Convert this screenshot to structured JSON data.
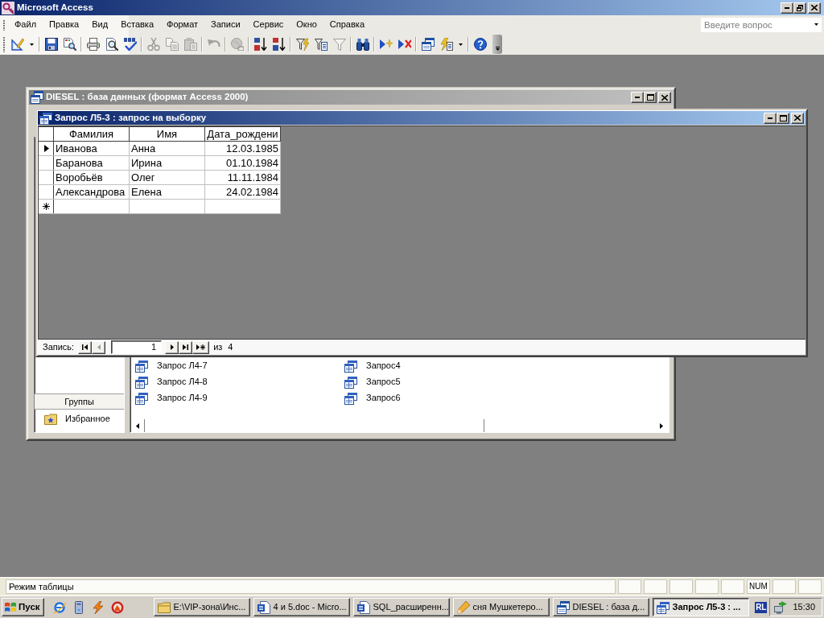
{
  "app": {
    "title": "Microsoft Access",
    "controls": [
      {
        "kind": "minimize"
      },
      {
        "kind": "restore"
      },
      {
        "kind": "close"
      }
    ]
  },
  "menu": [
    "Файл",
    "Правка",
    "Вид",
    "Вставка",
    "Формат",
    "Записи",
    "Сервис",
    "Окно",
    "Справка"
  ],
  "help_box": {
    "placeholder": "Введите вопрос"
  },
  "toolbar": [
    [
      {
        "kind": "view",
        "disabled": false,
        "dropdown": true
      }
    ],
    [
      {
        "kind": "save",
        "disabled": false,
        "dropdown": false
      },
      {
        "kind": "file_search",
        "disabled": false,
        "dropdown": false
      }
    ],
    [
      {
        "kind": "print",
        "disabled": false,
        "dropdown": false
      },
      {
        "kind": "preview",
        "disabled": false,
        "dropdown": false
      },
      {
        "kind": "spelling",
        "disabled": false,
        "dropdown": false
      }
    ],
    [
      {
        "kind": "cut",
        "disabled": true,
        "dropdown": false
      },
      {
        "kind": "copy",
        "disabled": true,
        "dropdown": false
      },
      {
        "kind": "paste",
        "disabled": true,
        "dropdown": false
      }
    ],
    [
      {
        "kind": "undo",
        "disabled": true,
        "dropdown": false
      }
    ],
    [
      {
        "kind": "hyperlink",
        "disabled": true,
        "dropdown": false
      }
    ],
    [
      {
        "kind": "sort_asc",
        "disabled": false,
        "dropdown": false
      },
      {
        "kind": "sort_desc",
        "disabled": false,
        "dropdown": false
      }
    ],
    [
      {
        "kind": "filter_selection",
        "disabled": false,
        "dropdown": false
      },
      {
        "kind": "filter_form",
        "disabled": false,
        "dropdown": false
      },
      {
        "kind": "apply_filter",
        "disabled": true,
        "dropdown": false
      }
    ],
    [
      {
        "kind": "find",
        "disabled": false,
        "dropdown": false
      }
    ],
    [
      {
        "kind": "new_record",
        "disabled": false,
        "dropdown": false
      },
      {
        "kind": "delete_record",
        "disabled": false,
        "dropdown": false
      }
    ],
    [
      {
        "kind": "db_window",
        "disabled": false,
        "dropdown": false
      },
      {
        "kind": "new_object",
        "disabled": false,
        "dropdown": true
      }
    ],
    [
      {
        "kind": "help",
        "disabled": false,
        "dropdown": false
      }
    ]
  ],
  "db_window": {
    "title": "DIESEL : база данных (формат Access 2000)",
    "active": false,
    "controls": [
      {
        "kind": "minimize"
      },
      {
        "kind": "maximize"
      },
      {
        "kind": "close"
      }
    ],
    "groups": {
      "header": "Группы",
      "items": [
        "Избранное"
      ]
    },
    "objects": [
      "Запрос Л4-7",
      "Запрос Л4-8",
      "Запрос Л4-9",
      "Запрос4",
      "Запрос5",
      "Запрос6"
    ]
  },
  "query_window": {
    "title": "Запрос Л5-3 : запрос на выборку",
    "active": true,
    "controls": [
      {
        "kind": "minimize"
      },
      {
        "kind": "maximize"
      },
      {
        "kind": "close"
      }
    ],
    "columns": [
      {
        "label": "Фамилия",
        "kind": "text"
      },
      {
        "label": "Имя",
        "kind": "text"
      },
      {
        "label": "Дата_рождени",
        "kind": "date"
      }
    ],
    "rows": [
      {
        "cells": [
          "Иванова",
          "Анна",
          "12.03.1985"
        ],
        "current": true
      },
      {
        "cells": [
          "Баранова",
          "Ирина",
          "01.10.1984"
        ],
        "current": false
      },
      {
        "cells": [
          "Воробьёв",
          "Олег",
          "11.11.1984"
        ],
        "current": false
      },
      {
        "cells": [
          "Александрова",
          "Елена",
          "24.02.1984"
        ],
        "current": false
      }
    ],
    "new_row": true,
    "navigator": {
      "label": "Запись:",
      "buttons_before": [
        {
          "kind": "first",
          "disabled": false
        },
        {
          "kind": "prev",
          "disabled": true
        }
      ],
      "record": "1",
      "buttons_after": [
        {
          "kind": "next",
          "disabled": false
        },
        {
          "kind": "last",
          "disabled": false
        },
        {
          "kind": "new",
          "disabled": false
        }
      ],
      "of": "из",
      "total": "4"
    }
  },
  "status_bar": {
    "text": "Режим таблицы",
    "indicators": [
      "NUM"
    ]
  },
  "taskbar": {
    "start": "Пуск",
    "quick_launch": [
      {
        "kind": "browser"
      },
      {
        "kind": "computer"
      },
      {
        "kind": "bolt"
      },
      {
        "kind": "flame"
      }
    ],
    "tasks": [
      {
        "kind": "folder",
        "label": "E:\\VIP-зона\\Инс...",
        "selected": false
      },
      {
        "kind": "document",
        "label": "4 и 5.doc - Micro...",
        "selected": false
      },
      {
        "kind": "document",
        "label": "SQL_расширенн...",
        "selected": false
      },
      {
        "kind": "pencil",
        "label": "сня Мушкетеро...",
        "selected": false
      },
      {
        "kind": "database",
        "label": "DIESEL : база д...",
        "selected": false
      },
      {
        "kind": "query",
        "label": "Запрос Л5-3 : ...",
        "selected": true
      }
    ],
    "language": "RL",
    "tray": [
      {
        "kind": "network"
      }
    ],
    "clock": "15:30"
  }
}
